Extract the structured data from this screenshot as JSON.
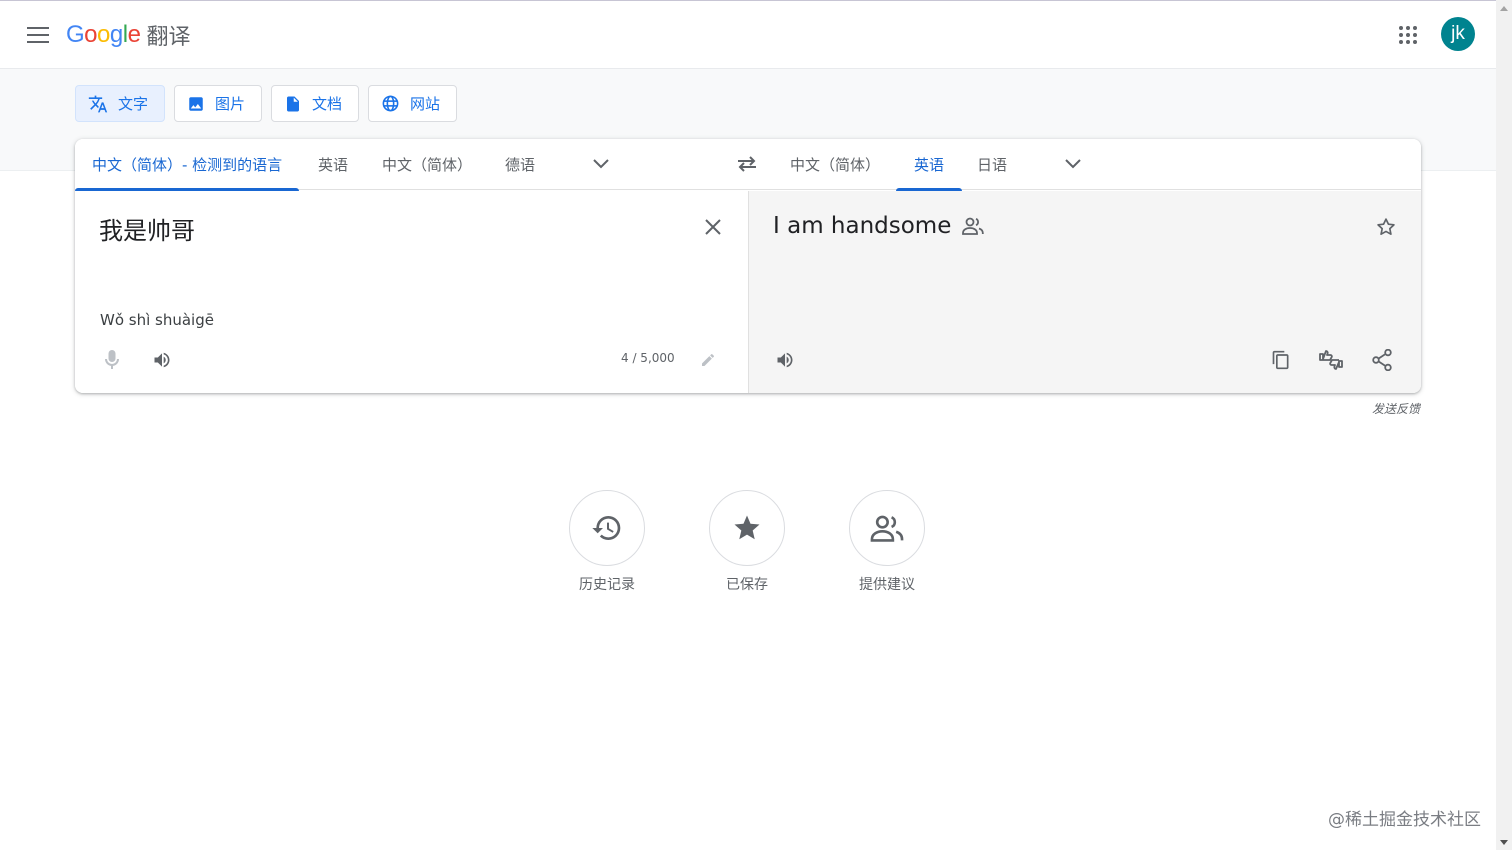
{
  "header": {
    "logo_letters": [
      {
        "ch": "G",
        "color": "#4285f4"
      },
      {
        "ch": "o",
        "color": "#ea4335"
      },
      {
        "ch": "o",
        "color": "#fbbc04"
      },
      {
        "ch": "g",
        "color": "#4285f4"
      },
      {
        "ch": "l",
        "color": "#34a853"
      },
      {
        "ch": "e",
        "color": "#ea4335"
      }
    ],
    "product_name": "翻译",
    "avatar_initials": "jk",
    "avatar_color": "#00838f",
    "menu_icon": "hamburger-menu-icon",
    "apps_icon": "apps-grid-icon"
  },
  "mode_tabs": [
    {
      "label": "文字",
      "icon": "translate-icon",
      "active": true
    },
    {
      "label": "图片",
      "icon": "image-icon",
      "active": false
    },
    {
      "label": "文档",
      "icon": "document-icon",
      "active": false
    },
    {
      "label": "网站",
      "icon": "globe-icon",
      "active": false
    }
  ],
  "source_langs": {
    "detected": "中文（简体）- 检测到的语言",
    "options": [
      "英语",
      "中文（简体）",
      "德语"
    ]
  },
  "target_langs": {
    "options": [
      "中文（简体）",
      "英语",
      "日语"
    ],
    "active": "英语"
  },
  "source": {
    "text": "我是帅哥",
    "transliteration": "Wǒ shì shuàigē",
    "char_count": "4 / 5,000"
  },
  "target": {
    "text": "I am handsome"
  },
  "feedback_label": "发送反馈",
  "hub": [
    {
      "label": "历史记录",
      "icon": "history-icon"
    },
    {
      "label": "已保存",
      "icon": "star-filled-icon"
    },
    {
      "label": "提供建议",
      "icon": "contribute-people-icon"
    }
  ],
  "watermark": "@稀土掘金技术社区",
  "colors": {
    "accent": "#1a73e8",
    "active_lang": "#1967d2",
    "icon_gray": "#5f6368",
    "target_bg": "#f5f5f5"
  }
}
